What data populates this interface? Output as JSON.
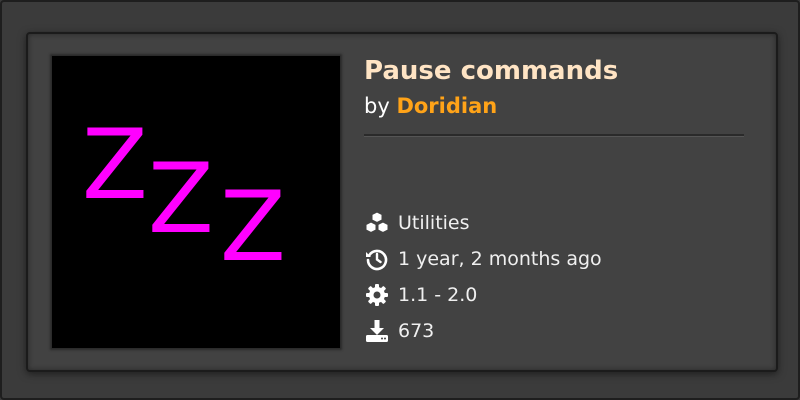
{
  "mod": {
    "title": "Pause commands",
    "by_prefix": "by",
    "author": "Doridian",
    "thumbnail_text": [
      "Z",
      "Z",
      "Z"
    ],
    "thumbnail_color": "#ff00ff",
    "category": "Utilities",
    "updated": "1 year, 2 months ago",
    "versions": "1.1 - 2.0",
    "downloads": "673"
  },
  "icons": {
    "category": "cubes-icon",
    "updated": "history-icon",
    "versions": "gear-icon",
    "downloads": "download-icon"
  },
  "colors": {
    "title": "#ffe4c4",
    "author": "#ffa318",
    "card_bg": "#424242",
    "frame_bg": "#3b3b3b"
  }
}
